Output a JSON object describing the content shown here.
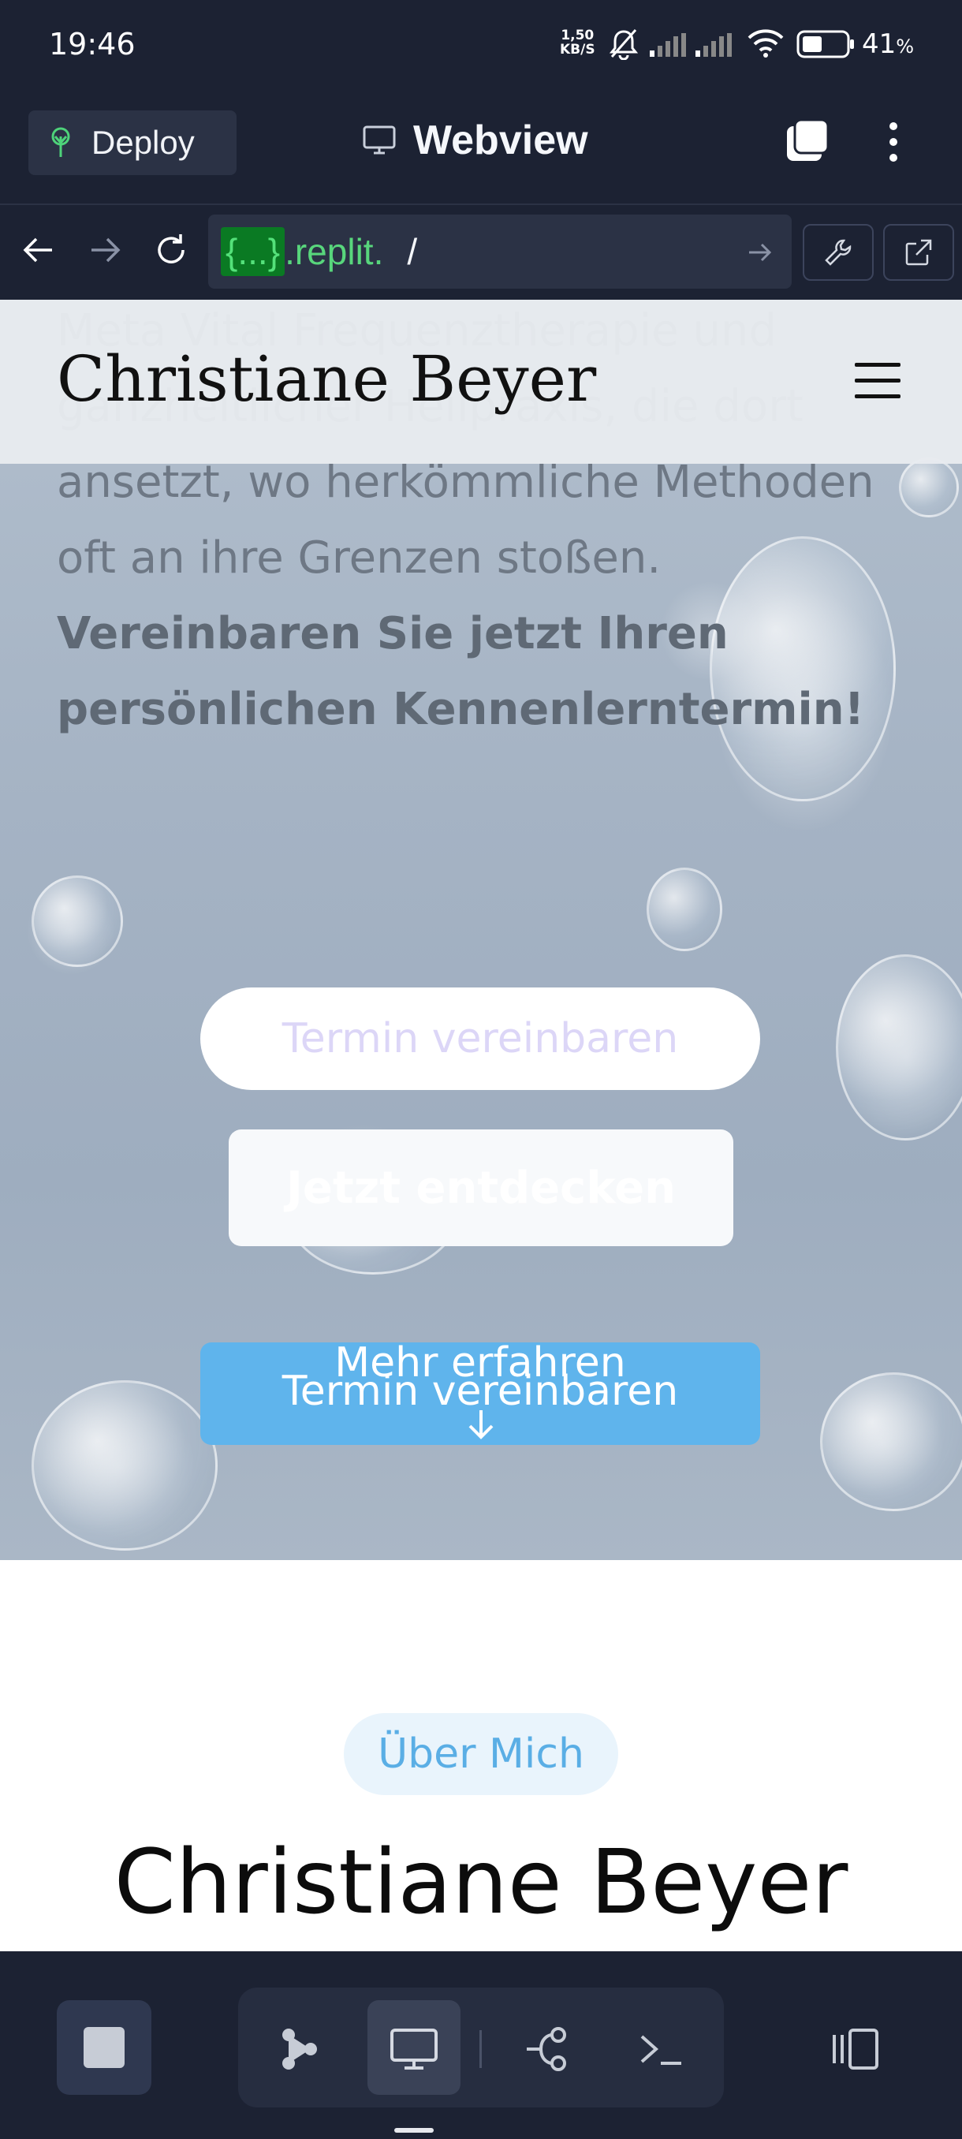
{
  "status_bar": {
    "time": "19:46",
    "net_speed_value": "1,50",
    "net_speed_unit": "KB/S",
    "battery_percent": "41",
    "battery_suffix": "%"
  },
  "app_header": {
    "deploy_label": "Deploy",
    "title": "Webview",
    "icons": [
      "tree-icon",
      "monitor-icon",
      "tabs-icon",
      "more-icon"
    ]
  },
  "url_bar": {
    "chip": "{...}",
    "domain": ".replit.",
    "path": "/"
  },
  "site": {
    "brand": "Christiane Beyer",
    "hero_text_plain": "Meta Vital Frequenztherapie und ganzheitlicher Heilpraxis, die dort ansetzt, wo herkömmliche Methoden oft an ihre Grenzen stoßen. ",
    "hero_text_bold": "Vereinbaren Sie jetzt Ihren persönlichen Kennenlerntermin!",
    "btn_termin_1": "Termin vereinbaren",
    "btn_entdecken": "Jetzt entdecken",
    "btn_termin_2": "Termin vereinbaren",
    "mehr_erfahren": "Mehr erfahren",
    "about_badge": "Über Mich",
    "about_name": "Christiane Beyer"
  },
  "colors": {
    "chrome_bg": "#1c2233",
    "accent_blue": "#5fb4ec",
    "replit_green": "#58d67c"
  }
}
